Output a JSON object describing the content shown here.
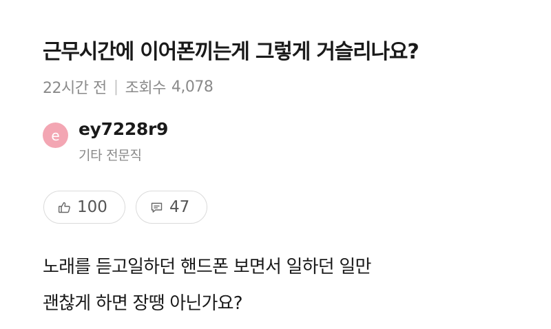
{
  "post": {
    "title": "근무시간에 이어폰끼는게 그렇게 거슬리나요?",
    "time_ago": "22시간 전",
    "divider": "|",
    "views_label": "조회수",
    "views_count": "4,078"
  },
  "author": {
    "avatar_letter": "e",
    "avatar_color": "#f3a6b3",
    "name": "ey7228r9",
    "job": "기타 전문직"
  },
  "actions": {
    "like_icon": "thumbs-up-icon",
    "like_count": "100",
    "comment_icon": "comment-icon",
    "comment_count": "47"
  },
  "body": {
    "lines": [
      "노래를 듣고일하던 핸드폰 보면서 일하던 일만",
      "괜찮게 하면 장땡 아닌가요?"
    ]
  }
}
